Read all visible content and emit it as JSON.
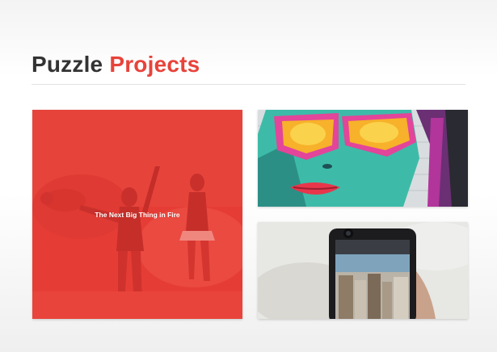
{
  "section": {
    "title_part1": "Puzzle",
    "title_part2": "Projects",
    "accent_color": "#e8433a"
  },
  "projects": [
    {
      "title": "The Next Big Thing in Fire",
      "image": "people-with-flares-photo",
      "overlay_color": "#e8433a"
    },
    {
      "image": "graffiti-woman-sunglasses-photo"
    },
    {
      "image": "phone-camera-city-photo"
    }
  ]
}
